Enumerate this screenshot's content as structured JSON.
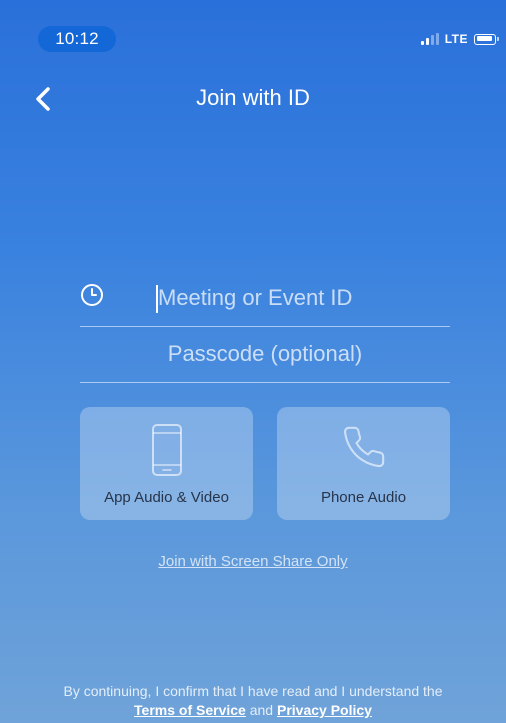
{
  "status_bar": {
    "time": "10:12",
    "network": "LTE",
    "icons": [
      "signal-icon",
      "battery-icon"
    ]
  },
  "nav": {
    "title": "Join with ID",
    "back_icon": "chevron-left-icon"
  },
  "form": {
    "meeting_id": {
      "value": "",
      "placeholder": "Meeting or Event ID",
      "icon": "clock-icon"
    },
    "passcode": {
      "value": "",
      "placeholder": "Passcode (optional)"
    }
  },
  "audio_options": [
    {
      "label": "App Audio & Video",
      "icon": "smartphone-icon"
    },
    {
      "label": "Phone Audio",
      "icon": "phone-icon"
    }
  ],
  "share_link": "Join with Screen Share Only",
  "legal": {
    "text": "By continuing, I confirm that I have read and I understand the",
    "terms": "Terms of Service",
    "and": "and",
    "privacy": "Privacy Policy"
  },
  "colors": {
    "background_top": "#2a70da",
    "background_bottom": "#6fa3d9",
    "time_pill": "#1467d6",
    "choice_label": "#27344a"
  }
}
